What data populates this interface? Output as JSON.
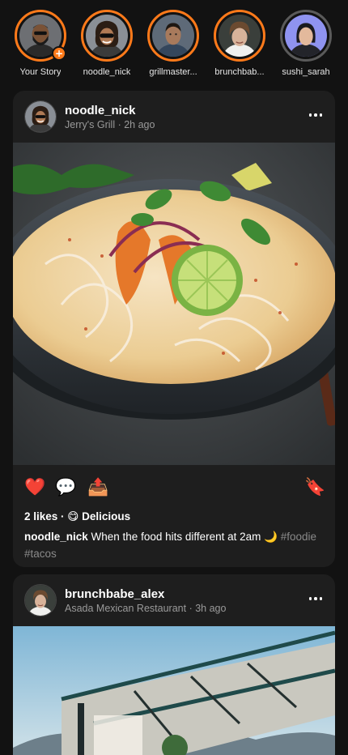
{
  "stories": [
    {
      "label": "Your Story",
      "seen": false,
      "is_own": true,
      "add_icon": "+"
    },
    {
      "label": "noodle_nick",
      "seen": false
    },
    {
      "label": "grillmaster...",
      "seen": false
    },
    {
      "label": "brunchbab...",
      "seen": false
    },
    {
      "label": "sushi_sarah",
      "seen": true
    }
  ],
  "posts": [
    {
      "username": "noodle_nick",
      "location": "Jerry's Grill",
      "time": "2h ago",
      "meta_sep": " · ",
      "actions": {
        "like": "❤️",
        "comment": "💬",
        "share": "📤",
        "save": "🔖"
      },
      "likes_text": "2 likes · 😋 Delicious",
      "caption_user": "noodle_nick",
      "caption_text": "When the food hits different at 2am 🌙",
      "hashtags": "#foodie #tacos"
    },
    {
      "username": "brunchbabe_alex",
      "location": "Asada Mexican Restaurant",
      "time": "3h ago",
      "meta_sep": " · "
    }
  ],
  "colors": {
    "story_ring": "#ff7a1a",
    "story_ring_seen": "#5a5a5a",
    "card_bg": "#1e1e1e",
    "page_bg": "#121212"
  }
}
